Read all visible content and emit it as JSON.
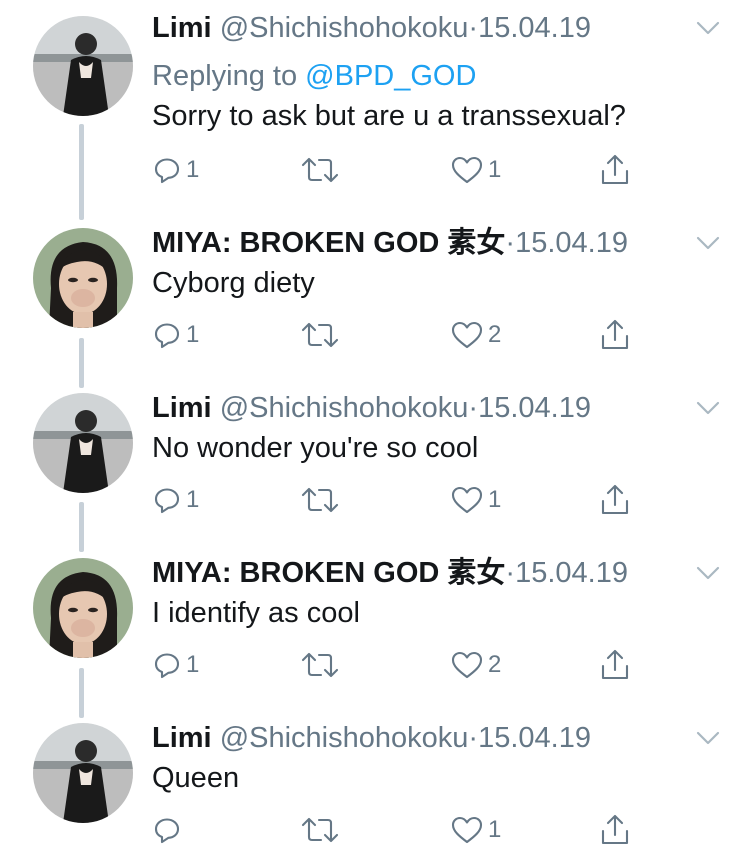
{
  "tweets": [
    {
      "name": "Limi",
      "handle": "@Shichishohokoku",
      "date": "15.04.19",
      "dot": "·",
      "reply_prefix": "Replying to",
      "reply_to": "@BPD_GOD",
      "text": "Sorry to ask but are u a transsexual?",
      "replies": "1",
      "retweets": "",
      "likes": "1",
      "avatar": "limi"
    },
    {
      "name": "MIYA: BROKEN GOD 素女",
      "handle": "",
      "date": "15.04.19",
      "dot": "·",
      "text": "Cyborg diety",
      "replies": "1",
      "retweets": "",
      "likes": "2",
      "avatar": "miya"
    },
    {
      "name": "Limi",
      "handle": "@Shichishohokoku",
      "date": "15.04.19",
      "dot": "·",
      "text": "No wonder you're so cool",
      "replies": "1",
      "retweets": "",
      "likes": "1",
      "avatar": "limi"
    },
    {
      "name": "MIYA: BROKEN GOD 素女",
      "handle": "",
      "date": "15.04.19",
      "dot": "·",
      "text": "I identify as cool",
      "replies": "1",
      "retweets": "",
      "likes": "2",
      "avatar": "miya"
    },
    {
      "name": "Limi",
      "handle": "@Shichishohokoku",
      "date": "15.04.19",
      "dot": "·",
      "text": "Queen",
      "replies": "",
      "retweets": "",
      "likes": "1",
      "avatar": "limi"
    }
  ],
  "colors": {
    "text": "#14171a",
    "secondary": "#657786",
    "mention": "#1da1f2",
    "thread_line": "#c7d0d8"
  },
  "icons": {
    "reply": "reply-icon",
    "retweet": "retweet-icon",
    "like": "heart-icon",
    "share": "share-icon",
    "menu": "chevron-down-icon"
  }
}
